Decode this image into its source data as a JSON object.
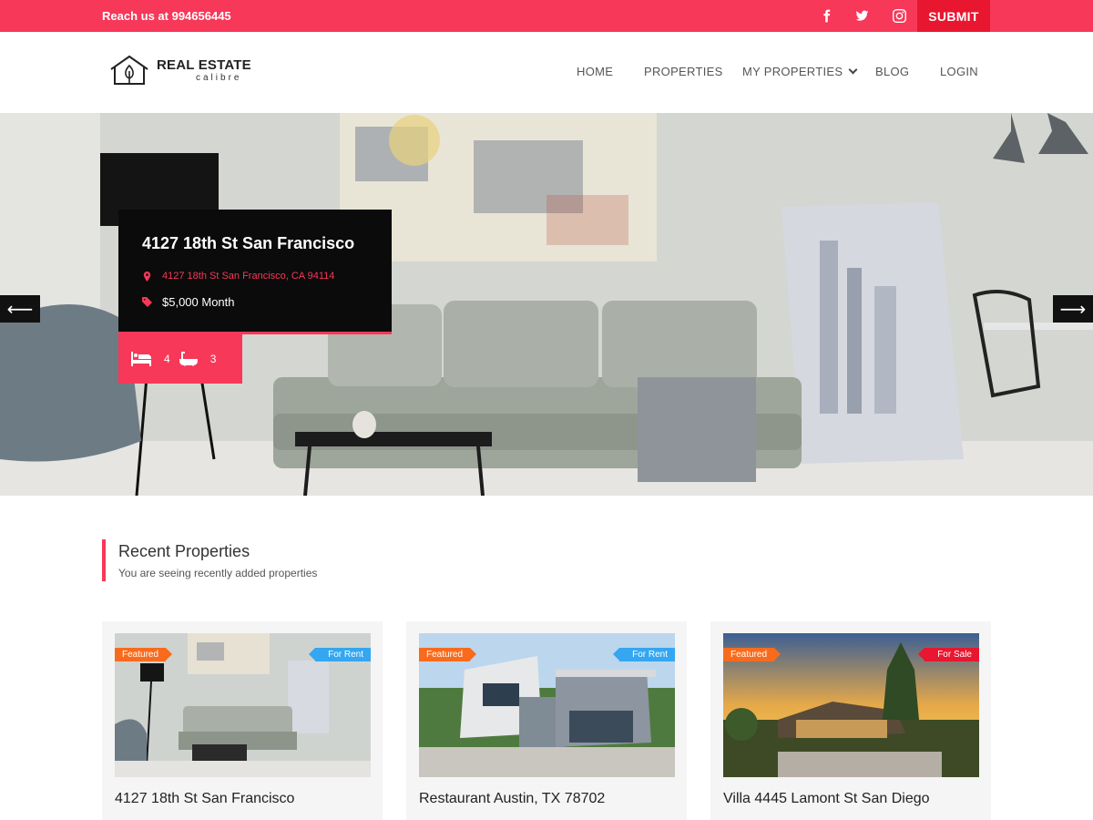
{
  "topbar": {
    "contact": "Reach us at 994656445",
    "social": [
      "facebook-icon",
      "twitter-icon",
      "instagram-icon"
    ],
    "submit_label": "SUBMIT"
  },
  "header": {
    "logo_title": "REAL ESTATE",
    "logo_subtitle": "calibre",
    "nav": {
      "home": "HOME",
      "properties": "PROPERTIES",
      "my_properties": "MY PROPERTIES",
      "blog": "BLOG",
      "login": "LOGIN"
    }
  },
  "hero": {
    "title": "4127 18th St San Francisco",
    "address": "4127 18th St San Francisco, CA 94114",
    "price": "$5,000 Month",
    "beds": "4",
    "baths": "3",
    "prev_arrow": "⟵",
    "next_arrow": "⟶"
  },
  "recent": {
    "heading": "Recent Properties",
    "subheading": "You are seeing recently added properties",
    "cards": [
      {
        "name": "4127 18th St San Francisco",
        "featured": "Featured",
        "status": "For Rent"
      },
      {
        "name": "Restaurant Austin, TX 78702",
        "featured": "Featured",
        "status": "For Rent"
      },
      {
        "name": "Villa 4445 Lamont St San Diego",
        "featured": "Featured",
        "status": "For Sale"
      }
    ]
  },
  "colors": {
    "accent": "#f73859",
    "submit_bg": "#e8162f",
    "featured": "#f96b1c",
    "for_rent": "#35a6f0",
    "for_sale": "#e8162f"
  }
}
